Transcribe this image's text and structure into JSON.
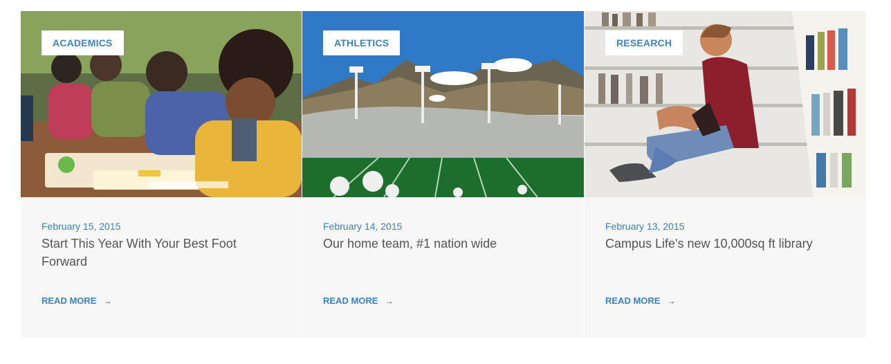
{
  "posts": [
    {
      "category": "ACADEMICS",
      "date": "February 15, 2015",
      "title": "Start This Year With Your Best Foot Forward",
      "read_more": "READ MORE",
      "arrow_icon": "→"
    },
    {
      "category": "ATHLETICS",
      "date": "February 14, 2015",
      "title": "Our home team, #1 nation wide",
      "read_more": "READ MORE",
      "arrow_icon": "→"
    },
    {
      "category": "RESEARCH",
      "date": "February 13, 2015",
      "title": "Campus Life's new 10,000sq ft library",
      "read_more": "READ MORE",
      "arrow_icon": "→"
    }
  ],
  "colors": {
    "accent": "#3f82c4",
    "card_background": "#f7f7f7",
    "title_text": "#555555"
  }
}
